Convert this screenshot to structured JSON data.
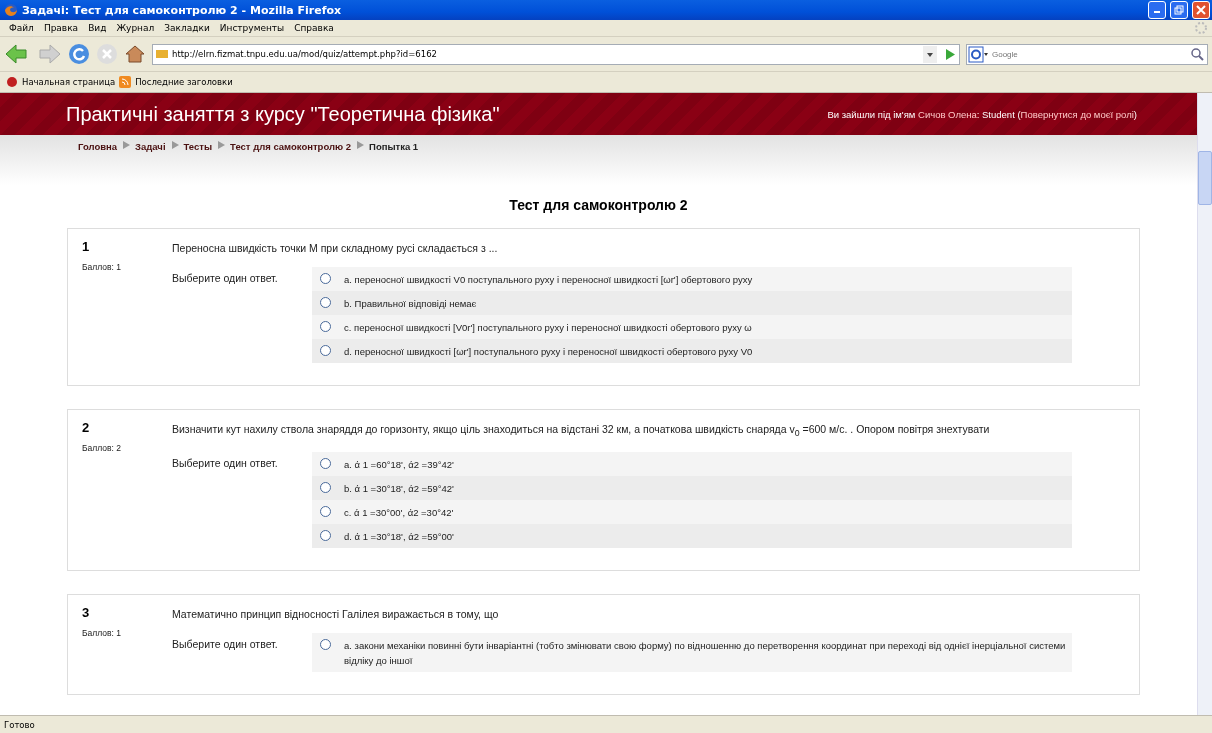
{
  "window": {
    "title": "Задачі: Тест для самоконтролю 2 - Mozilla Firefox"
  },
  "menu": [
    "Файл",
    "Правка",
    "Вид",
    "Журнал",
    "Закладки",
    "Инструменты",
    "Справка"
  ],
  "address": {
    "value": "http://elrn.fizmat.tnpu.edu.ua/mod/quiz/attempt.php?id=6162"
  },
  "search": {
    "placeholder": "Google"
  },
  "bookmarks": [
    "Начальная страница",
    "Последние заголовки"
  ],
  "site": {
    "title": "Практичні заняття з курсу \"Теоретична фізика\"",
    "login_prefix": "Ви зайшли під ім'ям",
    "user": "Сичов Олена",
    "role": ": Student (",
    "return_link": "Повернутися до моєї ролі",
    "close": ")"
  },
  "breadcrumb": [
    {
      "label": "Головна",
      "link": true
    },
    {
      "label": "Задачі",
      "link": true
    },
    {
      "label": "Тесты",
      "link": true
    },
    {
      "label": "Тест для самоконтролю 2",
      "link": true
    },
    {
      "label": "Попытка 1",
      "link": false
    }
  ],
  "quiz_title": "Тест для самоконтролю 2",
  "questions": [
    {
      "number": "1",
      "grade": "Баллов: 1",
      "text": "Переносна швидкість точки М при складному русі складається з ...",
      "prompt": "Выберите один ответ.",
      "answers": [
        {
          "label": "a. переносної швидкості V0 поступального руху і переносної швидкості [ωr'] обертового руху",
          "selected": false
        },
        {
          "label": "b. Правильної відповіді немає",
          "selected": false
        },
        {
          "label": "c. переносної швидкості [V0r'] поступального руху і переносної швидкості обертового руху ω",
          "selected": false
        },
        {
          "label": "d. переносної швидкості [ωr'] поступального руху і переносної швидкості обертового руху V0",
          "selected": false
        }
      ]
    },
    {
      "number": "2",
      "grade": "Баллов: 2",
      "text": "Визначити кут нахилу ствола знаряддя до горизонту, якщо ціль знаходиться на відстані 32 км, а початкова швидкість снаряда v$_{0}$ =600 м/с. . Опором повітря знехтувати",
      "prompt": "Выберите один ответ.",
      "answers": [
        {
          "label": "a. ά 1 =60°18', ά2 =39°42'",
          "selected": false
        },
        {
          "label": "b. ά 1 =30°18', ά2 =59°42'",
          "selected": false
        },
        {
          "label": "c. ά 1 =30°00', ά2 =30°42'",
          "selected": false
        },
        {
          "label": "d. ά 1 =30°18', ά2 =59°00'",
          "selected": false
        }
      ]
    },
    {
      "number": "3",
      "grade": "Баллов: 1",
      "text": "Математично принцип відносності Галілея виражається в тому, що",
      "prompt": "Выберите один ответ.",
      "answers": [
        {
          "label": "a. закони механіки повинні бути інваріантні (тобто змінювати свою форму) по відношенню до перетворення координат при переході від однієї інерціальної системи відліку до іншої",
          "selected": false
        }
      ]
    }
  ],
  "status_bar": "Готово"
}
